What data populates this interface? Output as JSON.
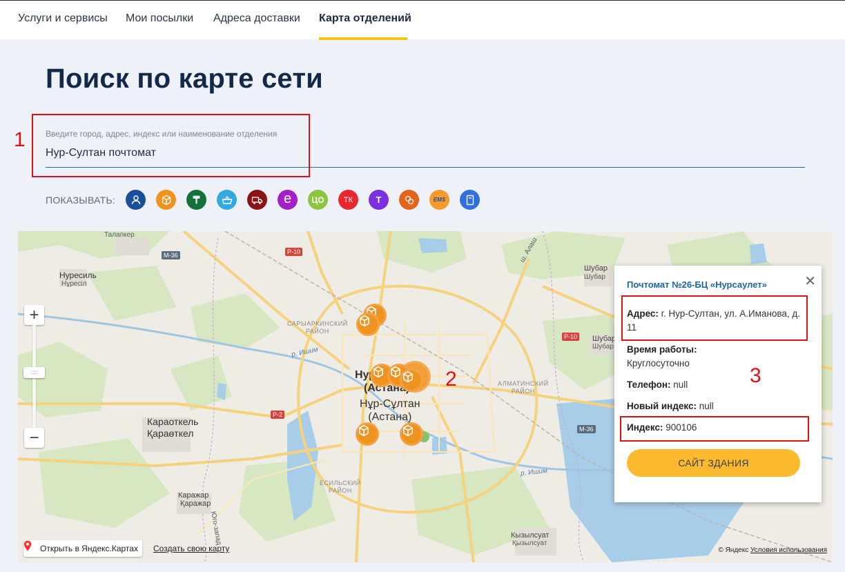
{
  "nav": {
    "tabs": [
      {
        "label": "Услуги и сервисы"
      },
      {
        "label": "Мои посылки"
      },
      {
        "label": "Адреса доставки"
      },
      {
        "label": "Карта отделений",
        "active": true
      }
    ]
  },
  "page": {
    "title": "Поиск по карте сети"
  },
  "search": {
    "placeholder": "Введите город, адрес, индекс или наименование отделения",
    "value": "Нур-Султан почтомат"
  },
  "filters": {
    "label": "ПОКАЗЫВАТЬ:",
    "items": [
      {
        "name": "person",
        "text": "",
        "color": "#1b4f9c"
      },
      {
        "name": "parcel-box",
        "text": "",
        "color": "#f0931e"
      },
      {
        "name": "tenge",
        "text": "₸",
        "color": "#17703a"
      },
      {
        "name": "basket",
        "text": "",
        "color": "#33a9e0"
      },
      {
        "name": "truck",
        "text": "",
        "color": "#8a1414"
      },
      {
        "name": "e-letter",
        "text": "e",
        "color": "#a31fc7"
      },
      {
        "name": "tso",
        "text": "ЦО",
        "color": "#8cc63f"
      },
      {
        "name": "tk",
        "text": "ТК",
        "color": "#e8282d"
      },
      {
        "name": "t-letter",
        "text": "T",
        "color": "#7a2fe0"
      },
      {
        "name": "exchange",
        "text": "",
        "color": "#e5641c"
      },
      {
        "name": "ems",
        "text": "EMS",
        "color": "#f59a2b"
      },
      {
        "name": "locker",
        "text": "",
        "color": "#2f6fe0"
      }
    ]
  },
  "annotations": {
    "one": "1",
    "two": "2",
    "three": "3"
  },
  "map": {
    "labels": {
      "talapker": "Талапкер",
      "nuresil_ru": "Нуресиль",
      "nuresil_kz": "Нұресіл",
      "karaotkel_ru": "Караоткель",
      "karaotkel_kz": "Қараөткел",
      "karazhar_ru": "Каражар",
      "karazhar_kz": "Қаражар",
      "shubar1": "Шубар",
      "shubar2": "Шубар",
      "shubar3": "Шубар",
      "shubar4": "Шубар",
      "kyzylsuat_ru": "Кызылсуат",
      "kyzylsuat_kz": "Қызылсуат",
      "saryarka": "САРЫАРКИНСКИЙ\nРАЙОН",
      "almaty": "АЛМАТИНСКИЙ\nРАЙОН",
      "esil": "ЕСИЛЬСКИЙ\nРАЙОН",
      "city_ru": "Нур-Султан\n(Астана)",
      "city_kz": "Нұр-Сұлтан\n(Астана)",
      "river1": "р. Ишим",
      "river2": "р. Ишим",
      "alash": "ш. Алаш",
      "ugo": "Юго-запад"
    },
    "roads": {
      "m36a": "М-36",
      "p10a": "Р-10",
      "p10b": "Р-10",
      "p2": "Р-2",
      "m36b": "М-36"
    },
    "zoom": {
      "plus": "+",
      "minus": "−",
      "handle": ":::::"
    },
    "open_yandex": "Открыть в Яндекс.Картах",
    "create_map": "Создать свою карту",
    "copyright": "© Яндекс",
    "terms": "Условия использования"
  },
  "popup": {
    "title": "Почтомат №26-БЦ «Нурсаулет»",
    "address_label": "Адрес:",
    "address_value": " г. Нур-Султан, ул. А.Иманова, д. 11",
    "hours_label": "Время работы:",
    "hours_value": "Круглосуточно",
    "phone_label": "Телефон:",
    "phone_value": " null",
    "new_index_label": "Новый индекс:",
    "new_index_value": " null",
    "index_label": "Индекс:",
    "index_value": " 900106",
    "button": "САЙТ ЗДАНИЯ",
    "close": "✕"
  }
}
